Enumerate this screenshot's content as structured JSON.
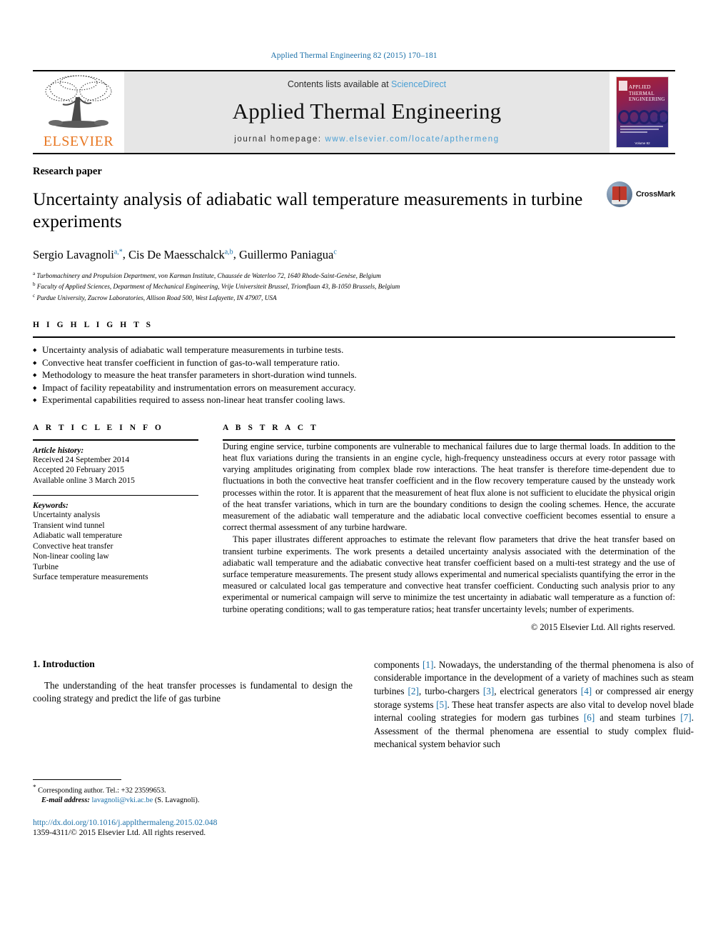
{
  "running_head": "Applied Thermal Engineering 82 (2015) 170–181",
  "masthead": {
    "publisher_name": "ELSEVIER",
    "contents_prefix": "Contents lists available at ",
    "contents_link": "ScienceDirect",
    "journal_name": "Applied Thermal Engineering",
    "homepage_prefix": "journal homepage: ",
    "homepage_link": "www.elsevier.com/locate/apthermeng",
    "cover": {
      "title_line1": "APPLIED",
      "title_line2": "THERMAL",
      "title_line3": "ENGINEERING",
      "volume_text": "Volume 82"
    }
  },
  "article": {
    "paper_type": "Research paper",
    "title": "Uncertainty analysis of adiabatic wall temperature measurements in turbine experiments",
    "authors": [
      {
        "name": "Sergio Lavagnoli",
        "marks": "a,*"
      },
      {
        "name": "Cis De Maesschalck",
        "marks": "a,b"
      },
      {
        "name": "Guillermo Paniagua",
        "marks": "c"
      }
    ],
    "affiliations": [
      {
        "mark": "a",
        "text": "Turbomachinery and Propulsion Department, von Karman Institute, Chaussée de Waterloo 72, 1640 Rhode-Saint-Genèse, Belgium"
      },
      {
        "mark": "b",
        "text": "Faculty of Applied Sciences, Department of Mechanical Engineering, Vrije Universiteit Brussel, Triomflaan 43, B-1050 Brussels, Belgium"
      },
      {
        "mark": "c",
        "text": "Purdue University, Zucrow Laboratories, Allison Road 500, West Lafayette, IN 47907, USA"
      }
    ],
    "crossmark_label": "CrossMark"
  },
  "highlights": {
    "heading": "H I G H L I G H T S",
    "items": [
      "Uncertainty analysis of adiabatic wall temperature measurements in turbine tests.",
      "Convective heat transfer coefficient in function of gas-to-wall temperature ratio.",
      "Methodology to measure the heat transfer parameters in short-duration wind tunnels.",
      "Impact of facility repeatability and instrumentation errors on measurement accuracy.",
      "Experimental capabilities required to assess non-linear heat transfer cooling laws."
    ]
  },
  "article_info": {
    "heading": "A R T I C L E   I N F O",
    "history_label": "Article history:",
    "history": [
      "Received 24 September 2014",
      "Accepted 20 February 2015",
      "Available online 3 March 2015"
    ],
    "keywords_label": "Keywords:",
    "keywords": [
      "Uncertainty analysis",
      "Transient wind tunnel",
      "Adiabatic wall temperature",
      "Convective heat transfer",
      "Non-linear cooling law",
      "Turbine",
      "Surface temperature measurements"
    ]
  },
  "abstract": {
    "heading": "A B S T R A C T",
    "paragraphs": [
      "During engine service, turbine components are vulnerable to mechanical failures due to large thermal loads. In addition to the heat flux variations during the transients in an engine cycle, high-frequency unsteadiness occurs at every rotor passage with varying amplitudes originating from complex blade row interactions. The heat transfer is therefore time-dependent due to fluctuations in both the convective heat transfer coefficient and in the flow recovery temperature caused by the unsteady work processes within the rotor. It is apparent that the measurement of heat flux alone is not sufficient to elucidate the physical origin of the heat transfer variations, which in turn are the boundary conditions to design the cooling schemes. Hence, the accurate measurement of the adiabatic wall temperature and the adiabatic local convective coefficient becomes essential to ensure a correct thermal assessment of any turbine hardware.",
      "This paper illustrates different approaches to estimate the relevant flow parameters that drive the heat transfer based on transient turbine experiments. The work presents a detailed uncertainty analysis associated with the determination of the adiabatic wall temperature and the adiabatic convective heat transfer coefficient based on a multi-test strategy and the use of surface temperature measurements. The present study allows experimental and numerical specialists quantifying the error in the measured or calculated local gas temperature and convective heat transfer coefficient. Conducting such analysis prior to any experimental or numerical campaign will serve to minimize the test uncertainty in adiabatic wall temperature as a function of: turbine operating conditions; wall to gas temperature ratios; heat transfer uncertainty levels; number of experiments."
    ],
    "copyright": "© 2015 Elsevier Ltd. All rights reserved."
  },
  "body": {
    "section_number_title": "1.  Introduction",
    "left_paragraph": "The understanding of the heat transfer processes is fundamental to design the cooling strategy and predict the life of gas turbine",
    "right_paragraph_parts": [
      {
        "t": "components "
      },
      {
        "t": "[1]",
        "cite": true
      },
      {
        "t": ". Nowadays, the understanding of the thermal phenomena is also of considerable importance in the development of a variety of machines such as steam turbines "
      },
      {
        "t": "[2]",
        "cite": true
      },
      {
        "t": ", turbo-chargers "
      },
      {
        "t": "[3]",
        "cite": true
      },
      {
        "t": ", electrical generators "
      },
      {
        "t": "[4]",
        "cite": true
      },
      {
        "t": " or compressed air energy storage systems "
      },
      {
        "t": "[5]",
        "cite": true
      },
      {
        "t": ". These heat transfer aspects are also vital to develop novel blade internal cooling strategies for modern gas turbines "
      },
      {
        "t": "[6]",
        "cite": true
      },
      {
        "t": " and steam turbines "
      },
      {
        "t": "[7]",
        "cite": true
      },
      {
        "t": ". Assessment of the thermal phenomena are essential to study complex fluid-mechanical system behavior such"
      }
    ]
  },
  "footnotes": {
    "corresponding": "Corresponding author. Tel.: +32 23599653.",
    "email_label": "E-mail address:",
    "email": "lavagnoli@vki.ac.be",
    "email_suffix": "(S. Lavagnoli).",
    "doi": "http://dx.doi.org/10.1016/j.applthermaleng.2015.02.048",
    "issn": "1359-4311/© 2015 Elsevier Ltd. All rights reserved."
  },
  "colors": {
    "link": "#1a6fa8",
    "sciencedirect": "#4a9fd4",
    "elsevier_orange": "#e87722",
    "band": "#e6e6e6"
  }
}
